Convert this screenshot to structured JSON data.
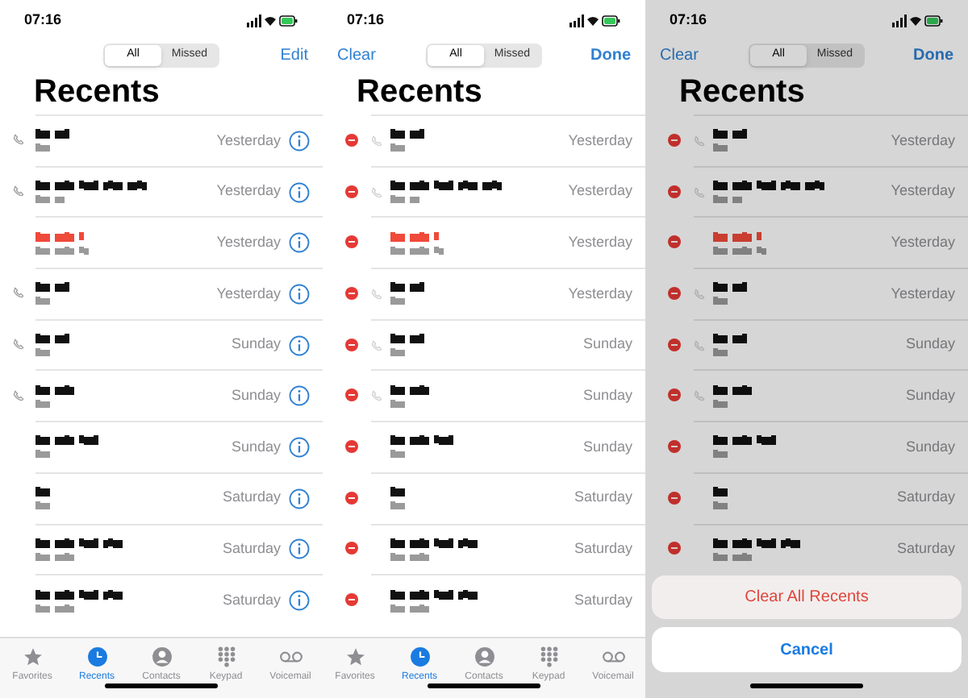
{
  "screens": [
    {
      "kind": "browse",
      "status_time": "07:16",
      "nav": {
        "right": "Edit",
        "segments": [
          {
            "label": "All",
            "selected": true
          },
          {
            "label": "Missed",
            "selected": false
          }
        ]
      },
      "title": "Recents",
      "rows": [
        {
          "day": "Yesterday",
          "missed": false,
          "call_icon": true
        },
        {
          "day": "Yesterday",
          "missed": false,
          "call_icon": true
        },
        {
          "day": "Yesterday",
          "missed": true,
          "call_icon": false
        },
        {
          "day": "Yesterday",
          "missed": false,
          "call_icon": true
        },
        {
          "day": "Sunday",
          "missed": false,
          "call_icon": true
        },
        {
          "day": "Sunday",
          "missed": false,
          "call_icon": true
        },
        {
          "day": "Sunday",
          "missed": false,
          "call_icon": false
        },
        {
          "day": "Saturday",
          "missed": false,
          "call_icon": false
        },
        {
          "day": "Saturday",
          "missed": false,
          "call_icon": false
        },
        {
          "day": "Saturday",
          "missed": false,
          "call_icon": false
        }
      ],
      "tabs": [
        {
          "label": "Favorites",
          "selected": false
        },
        {
          "label": "Recents",
          "selected": true
        },
        {
          "label": "Contacts",
          "selected": false
        },
        {
          "label": "Keypad",
          "selected": false
        },
        {
          "label": "Voicemail",
          "selected": false
        }
      ]
    },
    {
      "kind": "edit",
      "status_time": "07:16",
      "nav": {
        "left": "Clear",
        "right": "Done",
        "segments": [
          {
            "label": "All",
            "selected": true
          },
          {
            "label": "Missed",
            "selected": false
          }
        ]
      },
      "title": "Recents",
      "rows": [
        {
          "day": "Yesterday",
          "missed": false,
          "call_icon": true
        },
        {
          "day": "Yesterday",
          "missed": false,
          "call_icon": true
        },
        {
          "day": "Yesterday",
          "missed": true,
          "call_icon": false
        },
        {
          "day": "Yesterday",
          "missed": false,
          "call_icon": true
        },
        {
          "day": "Sunday",
          "missed": false,
          "call_icon": true
        },
        {
          "day": "Sunday",
          "missed": false,
          "call_icon": true
        },
        {
          "day": "Sunday",
          "missed": false,
          "call_icon": false
        },
        {
          "day": "Saturday",
          "missed": false,
          "call_icon": false
        },
        {
          "day": "Saturday",
          "missed": false,
          "call_icon": false
        },
        {
          "day": "Saturday",
          "missed": false,
          "call_icon": false
        }
      ],
      "tabs": [
        {
          "label": "Favorites",
          "selected": false
        },
        {
          "label": "Recents",
          "selected": true
        },
        {
          "label": "Contacts",
          "selected": false
        },
        {
          "label": "Keypad",
          "selected": false
        },
        {
          "label": "Voicemail",
          "selected": false
        }
      ]
    },
    {
      "kind": "confirm",
      "status_time": "07:16",
      "nav": {
        "left": "Clear",
        "right": "Done",
        "segments": [
          {
            "label": "All",
            "selected": true
          },
          {
            "label": "Missed",
            "selected": false
          }
        ]
      },
      "title": "Recents",
      "rows": [
        {
          "day": "Yesterday",
          "missed": false,
          "call_icon": true
        },
        {
          "day": "Yesterday",
          "missed": false,
          "call_icon": true
        },
        {
          "day": "Yesterday",
          "missed": true,
          "call_icon": false
        },
        {
          "day": "Yesterday",
          "missed": false,
          "call_icon": true
        },
        {
          "day": "Sunday",
          "missed": false,
          "call_icon": true
        },
        {
          "day": "Sunday",
          "missed": false,
          "call_icon": true
        },
        {
          "day": "Sunday",
          "missed": false,
          "call_icon": false
        },
        {
          "day": "Saturday",
          "missed": false,
          "call_icon": false
        },
        {
          "day": "Saturday",
          "missed": false,
          "call_icon": false
        }
      ],
      "action_sheet": {
        "destructive": "Clear All Recents",
        "cancel": "Cancel"
      }
    }
  ]
}
